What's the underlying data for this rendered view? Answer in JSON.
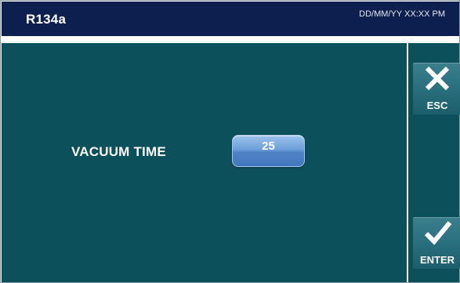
{
  "header": {
    "title": "R134a",
    "datetime": "DD/MM/YY XX:XX PM"
  },
  "main": {
    "field_label": "VACUUM TIME",
    "field_value": "25"
  },
  "side": {
    "esc_label": "ESC",
    "enter_label": "ENTER"
  },
  "colors": {
    "header_bg": "#0c1f4e",
    "panel_bg": "#0b505b",
    "value_button": "#5b8fd0"
  },
  "icons": [
    "close-icon",
    "check-icon"
  ]
}
